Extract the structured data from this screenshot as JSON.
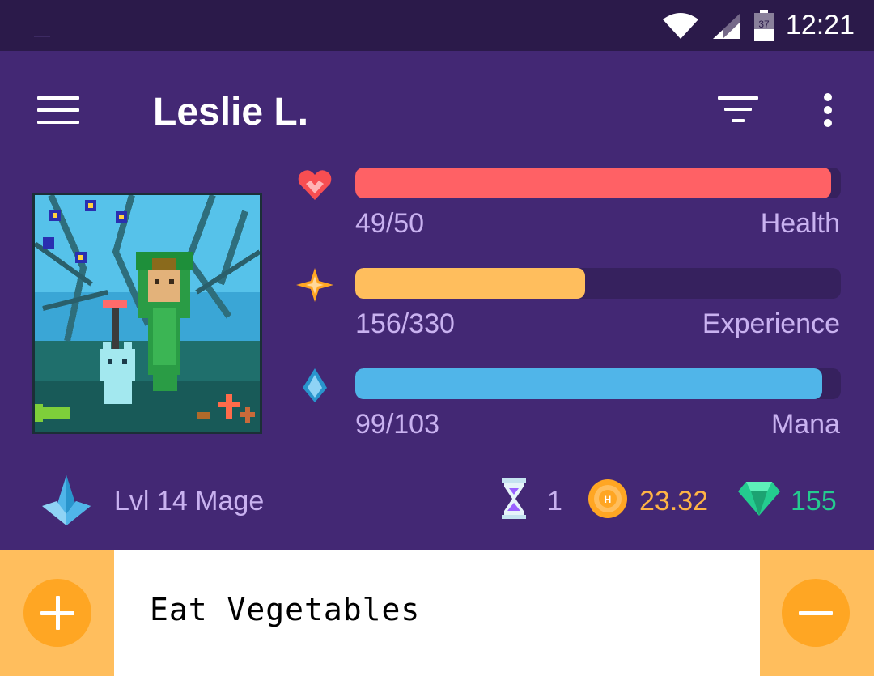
{
  "status_bar": {
    "time": "12:21",
    "battery_level": "37",
    "icons": [
      "wifi-icon",
      "cell-signal-icon",
      "battery-icon"
    ]
  },
  "app_bar": {
    "title": "Leslie L.",
    "icons": [
      "menu-icon",
      "filter-icon",
      "more-vert-icon"
    ]
  },
  "stats": [
    {
      "name": "Health",
      "value_text": "49/50",
      "current": 49,
      "max": 50,
      "color": "#ff6165",
      "icon": "heart-icon"
    },
    {
      "name": "Experience",
      "value_text": "156/330",
      "current": 156,
      "max": 330,
      "color": "#ffbe5d",
      "icon": "star-icon"
    },
    {
      "name": "Mana",
      "value_text": "99/103",
      "current": 99,
      "max": 103,
      "color": "#50b5e9",
      "icon": "mana-drop-icon"
    }
  ],
  "info": {
    "class_label": "Lvl 14 Mage",
    "class_icon": "mage-crystal-icon",
    "hourglasses": "1",
    "gold": "23.32",
    "gems": "155",
    "colors": {
      "gold": "#ffb445",
      "gems": "#24cc8f",
      "text": "#c9b2f0"
    }
  },
  "habit": {
    "title": "Eat Vegetables",
    "plus_icon": "plus-icon",
    "minus_icon": "minus-icon"
  },
  "colors": {
    "primary": "#432874",
    "status_bar": "#2b1a4a",
    "habit_side": "#ffbe5d",
    "habit_button": "#ffa623"
  }
}
